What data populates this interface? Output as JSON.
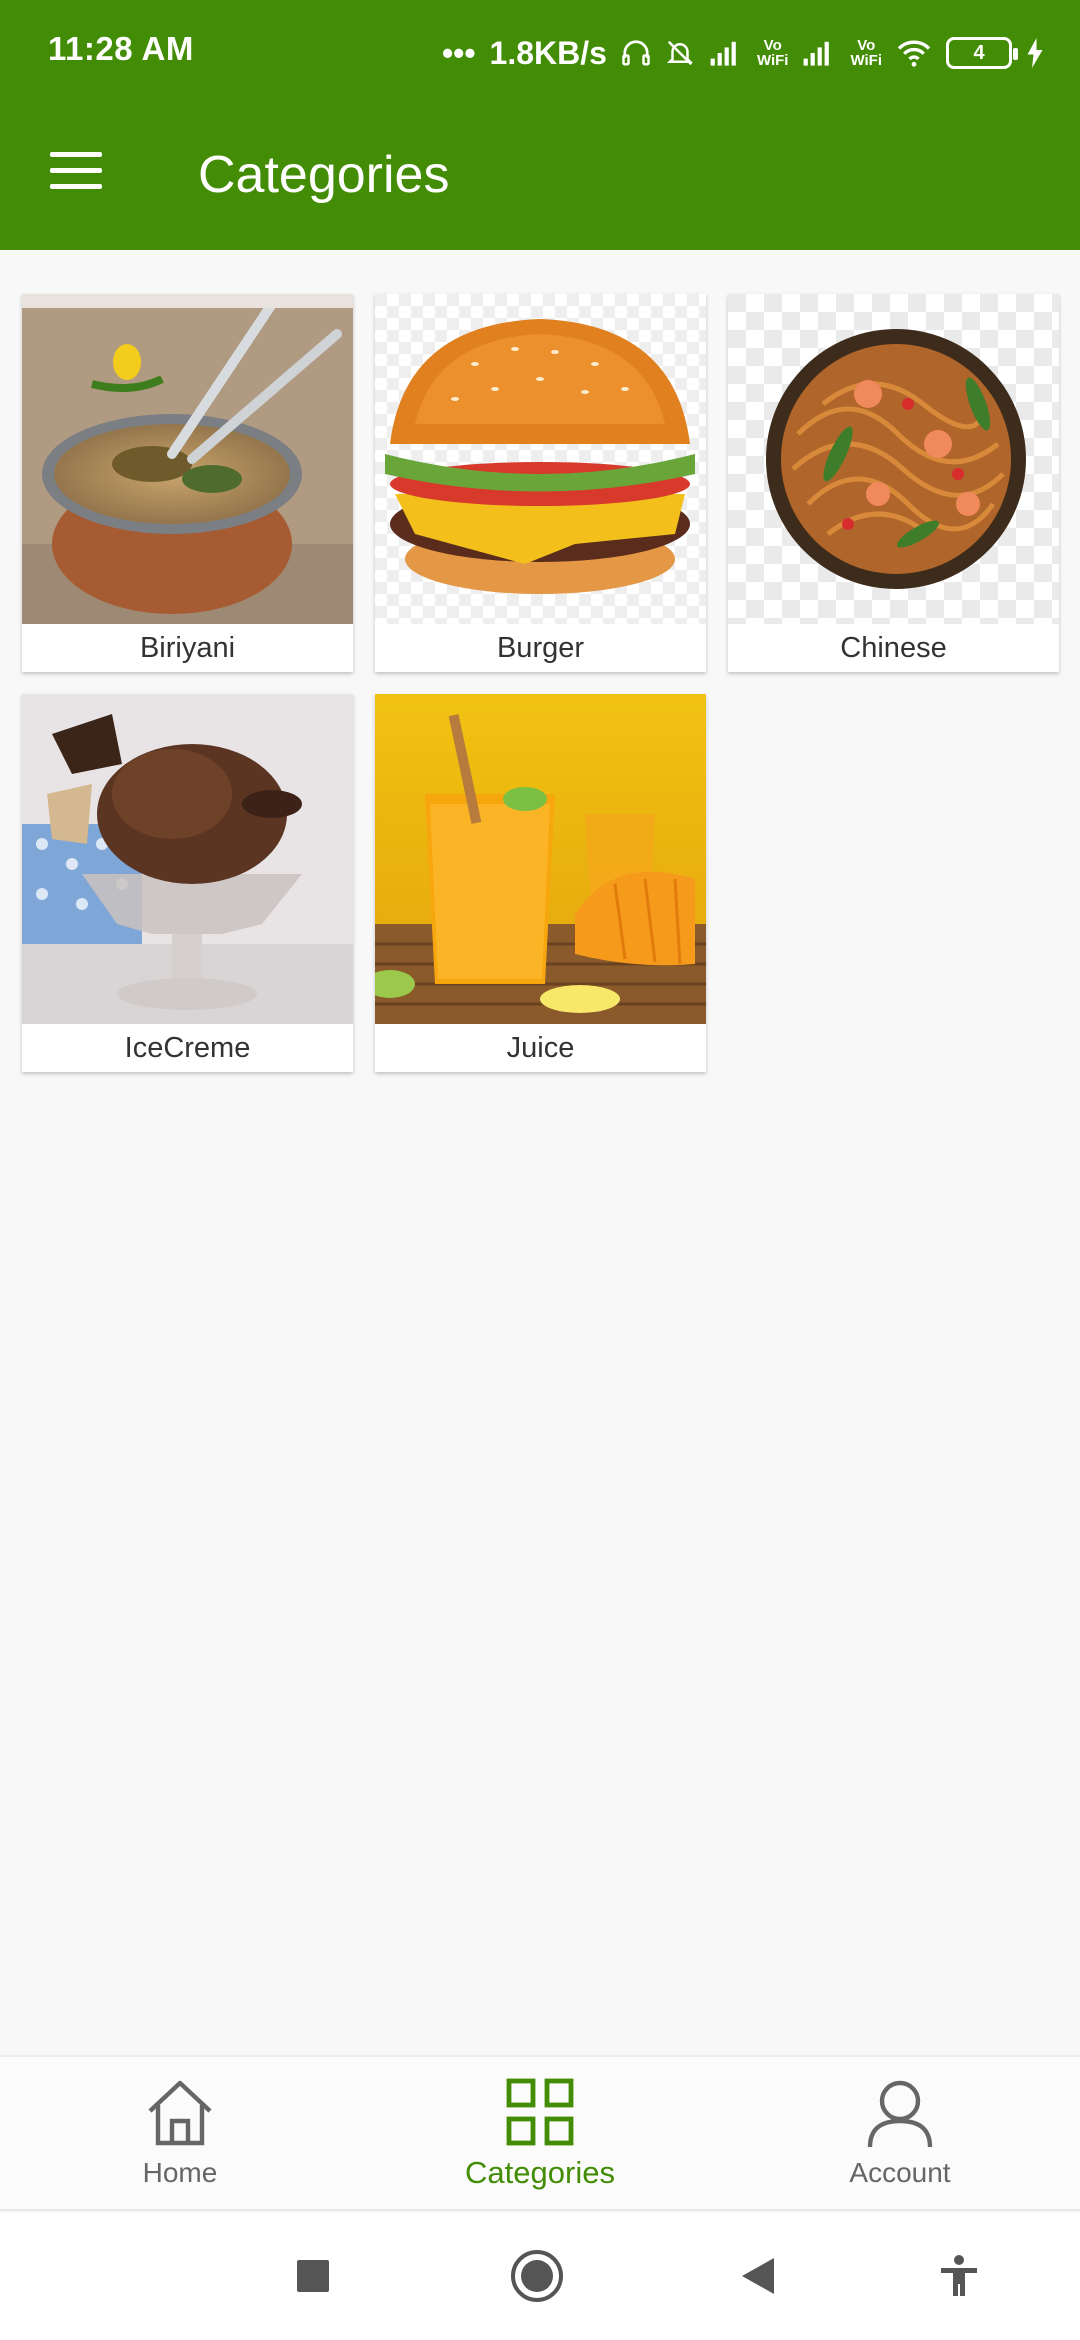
{
  "status_bar": {
    "time": "11:28 AM",
    "network_speed": "1.8KB/s",
    "sim_label": "Vo\nWiFi",
    "battery": "4",
    "icons": [
      "dots-icon",
      "headphones-icon",
      "bell-off-icon",
      "signal-icon",
      "vowifi-icon",
      "signal-icon",
      "vowifi-icon",
      "wifi-icon",
      "battery-icon",
      "charging-icon"
    ]
  },
  "app_bar": {
    "title": "Categories",
    "menu_icon": "menu-icon"
  },
  "categories": [
    {
      "label": "Biriyani",
      "image": "biriyani-image"
    },
    {
      "label": "Burger",
      "image": "burger-image"
    },
    {
      "label": "Chinese",
      "image": "chinese-image"
    },
    {
      "label": "IceCreme",
      "image": "icecream-image"
    },
    {
      "label": "Juice",
      "image": "juice-image"
    }
  ],
  "bottom_nav": {
    "items": [
      {
        "label": "Home",
        "icon": "home-icon",
        "active": false
      },
      {
        "label": "Categories",
        "icon": "grid-icon",
        "active": true
      },
      {
        "label": "Account",
        "icon": "account-icon",
        "active": false
      }
    ]
  },
  "system_nav": {
    "buttons": [
      "recents-button",
      "home-button",
      "back-button",
      "accessibility-button"
    ]
  },
  "colors": {
    "primary": "#438c06",
    "background": "#f8f8f8",
    "inactive": "#666666"
  }
}
